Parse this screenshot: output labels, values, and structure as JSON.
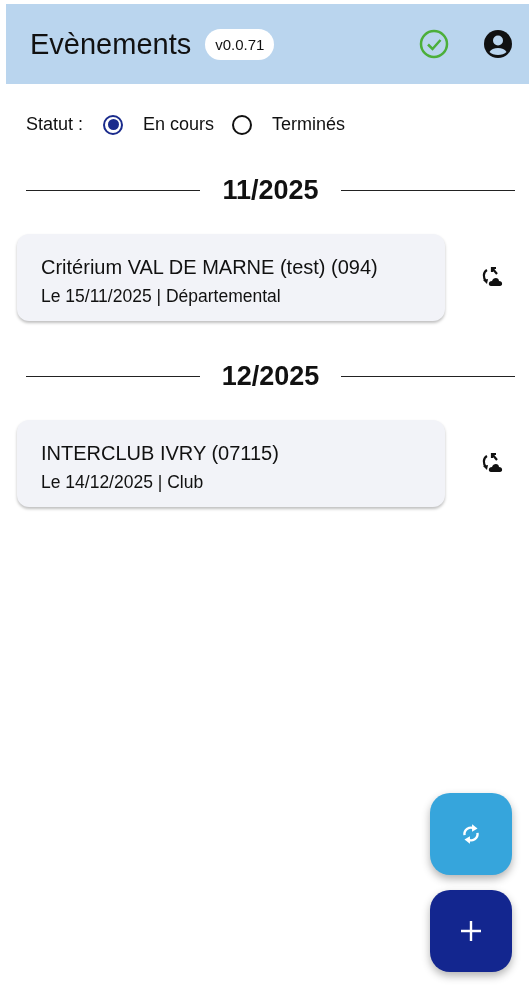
{
  "header": {
    "title": "Evènements",
    "version": "v0.0.71"
  },
  "filter": {
    "label": "Statut :",
    "options": [
      {
        "label": "En cours",
        "selected": true
      },
      {
        "label": "Terminés",
        "selected": false
      }
    ]
  },
  "groups": [
    {
      "month": "11/2025",
      "events": [
        {
          "title": "Critérium VAL DE MARNE (test) (094)",
          "details": "Le 15/11/2025 | Départemental"
        }
      ]
    },
    {
      "month": "12/2025",
      "events": [
        {
          "title": "INTERCLUB IVRY (07115)",
          "details": "Le 14/12/2025 | Club"
        }
      ]
    }
  ]
}
